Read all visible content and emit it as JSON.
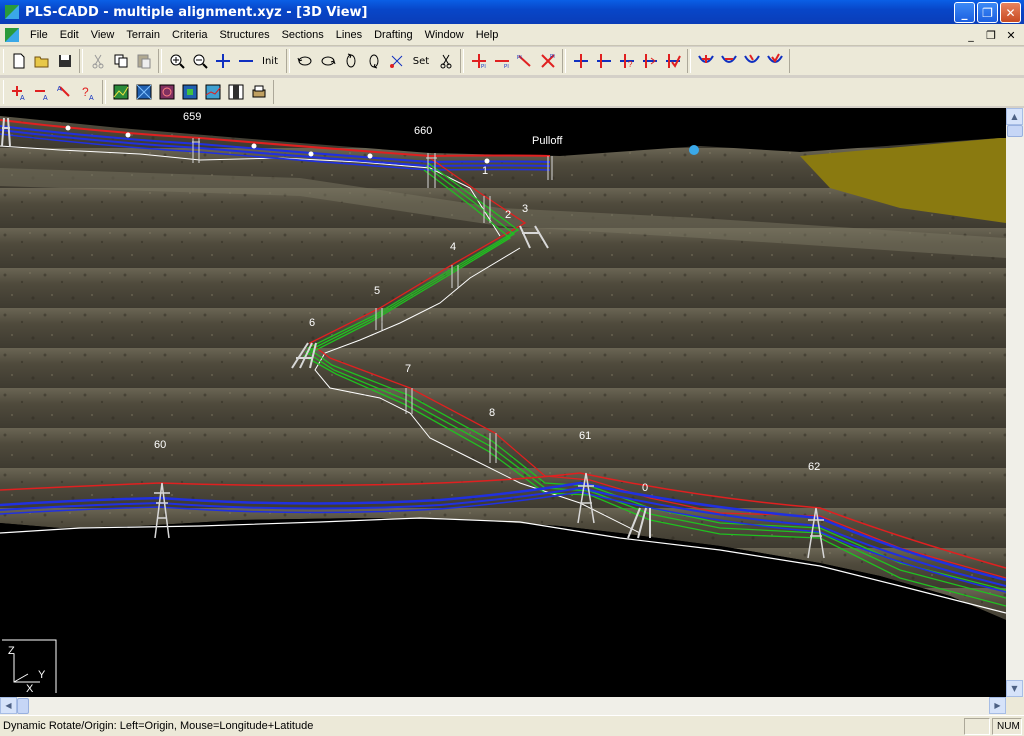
{
  "window": {
    "title": "PLS-CADD - multiple alignment.xyz - [3D View]",
    "buttons": [
      "_",
      "❐",
      "✕"
    ]
  },
  "menubar": {
    "items": [
      "File",
      "Edit",
      "View",
      "Terrain",
      "Criteria",
      "Structures",
      "Sections",
      "Lines",
      "Drafting",
      "Window",
      "Help"
    ],
    "mdi_buttons": [
      "_",
      "❐",
      "✕"
    ]
  },
  "toolbar": {
    "init_label": "Init",
    "set_label": "Set"
  },
  "scene": {
    "structure_labels": [
      {
        "id": "659",
        "text": "659"
      },
      {
        "id": "660",
        "text": "660"
      },
      {
        "id": "pulloff",
        "text": "Pulloff"
      },
      {
        "id": "s1",
        "text": "1"
      },
      {
        "id": "s2",
        "text": "2"
      },
      {
        "id": "s3",
        "text": "3"
      },
      {
        "id": "s4",
        "text": "4"
      },
      {
        "id": "s5",
        "text": "5"
      },
      {
        "id": "s6",
        "text": "6"
      },
      {
        "id": "s7",
        "text": "7"
      },
      {
        "id": "s8",
        "text": "8"
      },
      {
        "id": "60",
        "text": "60"
      },
      {
        "id": "61",
        "text": "61"
      },
      {
        "id": "s0",
        "text": "0"
      },
      {
        "id": "62",
        "text": "62"
      }
    ],
    "axis_labels": {
      "z": "Z",
      "y": "Y",
      "x": "X"
    },
    "colors": {
      "sky": "#000000",
      "terrain": "#4a4538",
      "red_conductor": "#e02020",
      "blue_conductor": "#2030e0",
      "green_conductor": "#20c020",
      "ground_line": "#ffffff",
      "yellow_surface": "#8a7a10",
      "marker": "#3aa8e8"
    }
  },
  "statusbar": {
    "text": "Dynamic Rotate/Origin: Left=Origin, Mouse=Longitude+Latitude",
    "num": "NUM"
  }
}
